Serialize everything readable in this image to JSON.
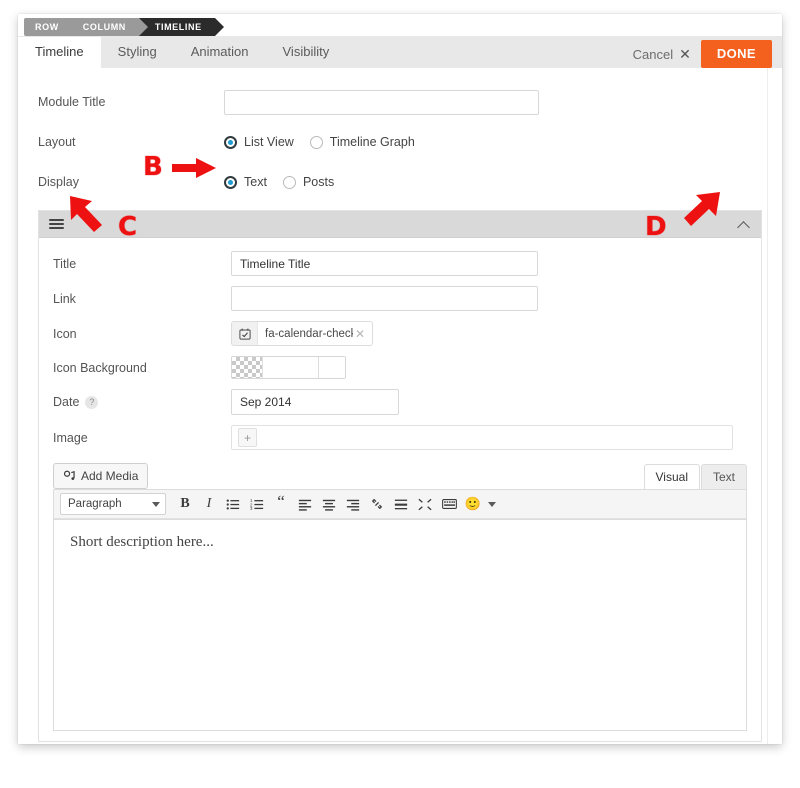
{
  "breadcrumb": {
    "items": [
      {
        "label": "ROW",
        "active": false
      },
      {
        "label": "COLUMN",
        "active": false
      },
      {
        "label": "TIMELINE",
        "active": true
      }
    ]
  },
  "header": {
    "tabs": [
      {
        "label": "Timeline",
        "active": true
      },
      {
        "label": "Styling",
        "active": false
      },
      {
        "label": "Animation",
        "active": false
      },
      {
        "label": "Visibility",
        "active": false
      }
    ],
    "cancel_label": "Cancel",
    "cancel_icon": "close-icon",
    "done_label": "DONE",
    "done_color": "#f4601d"
  },
  "form": {
    "module_title": {
      "label": "Module Title",
      "value": "",
      "placeholder": ""
    },
    "layout": {
      "label": "Layout",
      "options": [
        {
          "label": "List View",
          "selected": true
        },
        {
          "label": "Timeline Graph",
          "selected": false
        }
      ]
    },
    "display": {
      "label": "Display",
      "options": [
        {
          "label": "Text",
          "selected": true
        },
        {
          "label": "Posts",
          "selected": false
        }
      ]
    }
  },
  "accordion": {
    "drag_handle_icon": "hamburger-icon",
    "collapse_icon": "chevron-up-icon",
    "fields": {
      "title": {
        "label": "Title",
        "value": "Timeline Title"
      },
      "link": {
        "label": "Link",
        "value": ""
      },
      "icon": {
        "label": "Icon",
        "glyph": "calendar-check-icon",
        "value": "fa-calendar-check",
        "clear_icon": "close-icon"
      },
      "icon_background": {
        "label": "Icon Background",
        "value": "",
        "swatch": "transparent"
      },
      "date": {
        "label": "Date",
        "value": "Sep 2014",
        "help_icon": "?"
      },
      "image": {
        "label": "Image",
        "add_icon": "+"
      }
    }
  },
  "editor": {
    "add_media_label": "Add Media",
    "add_media_icon": "media-icon",
    "tabs": [
      {
        "label": "Visual",
        "active": true
      },
      {
        "label": "Text",
        "active": false
      }
    ],
    "format_select": "Paragraph",
    "toolbar_buttons": [
      {
        "name": "bold-icon",
        "glyph": "B"
      },
      {
        "name": "italic-icon",
        "glyph": "I"
      },
      {
        "name": "bulleted-list-icon",
        "glyph": ""
      },
      {
        "name": "numbered-list-icon",
        "glyph": ""
      },
      {
        "name": "blockquote-icon",
        "glyph": "“"
      },
      {
        "name": "align-left-icon",
        "glyph": ""
      },
      {
        "name": "align-center-icon",
        "glyph": ""
      },
      {
        "name": "align-right-icon",
        "glyph": ""
      },
      {
        "name": "insert-link-icon",
        "glyph": ""
      },
      {
        "name": "read-more-icon",
        "glyph": ""
      },
      {
        "name": "fullscreen-icon",
        "glyph": ""
      },
      {
        "name": "keyboard-shortcuts-icon",
        "glyph": ""
      },
      {
        "name": "emoji-icon",
        "glyph": "🙂"
      }
    ],
    "content": "Short description here..."
  },
  "annotations": [
    {
      "label": "B",
      "target": "display-radio-text",
      "direction": "right"
    },
    {
      "label": "C",
      "target": "accordion-drag-handle",
      "direction": "up-left"
    },
    {
      "label": "D",
      "target": "accordion-collapse-toggle",
      "direction": "up-right"
    }
  ]
}
